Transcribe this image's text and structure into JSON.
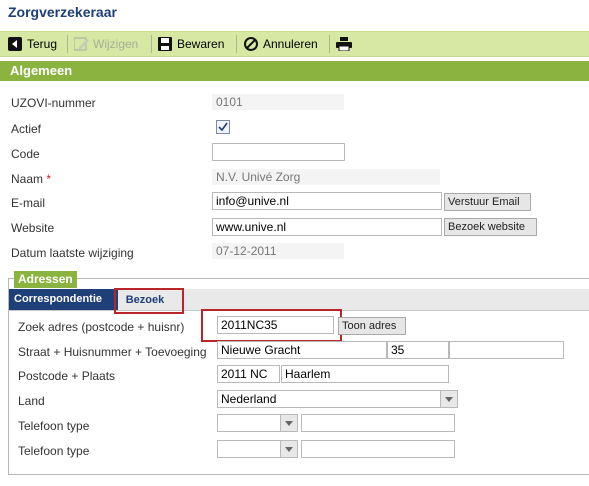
{
  "header": {
    "title": "Zorgverzekeraar"
  },
  "toolbar": {
    "back_label": "Terug",
    "edit_label": "Wijzigen",
    "save_label": "Bewaren",
    "cancel_label": "Annuleren"
  },
  "general": {
    "section_title": "Algemeen",
    "uzovi_label": "UZOVI-nummer",
    "uzovi_value": "0101",
    "active_label": "Actief",
    "active_checked": true,
    "code_label": "Code",
    "code_value": "",
    "name_label": "Naam",
    "name_required_mark": "*",
    "name_value": "N.V. Univé Zorg",
    "email_label": "E-mail",
    "email_value": "info@unive.nl",
    "send_email_label": "Verstuur Email",
    "website_label": "Website",
    "website_value": "www.unive.nl",
    "visit_website_label": "Bezoek website",
    "last_modified_label": "Datum laatste wijziging",
    "last_modified_value": "07-12-2011"
  },
  "addresses": {
    "legend": "Adressen",
    "tabs": [
      "Correspondentie",
      "Bezoek"
    ],
    "search_label": "Zoek adres (postcode + huisnr)",
    "search_value": "2011NC35",
    "show_address_label": "Toon adres",
    "street_label": "Straat + Huisnummer + Toevoeging",
    "street_value": "Nieuwe Gracht",
    "house_number_value": "35",
    "addition_value": "",
    "postcode_label": "Postcode + Plaats",
    "postcode_value": "2011 NC",
    "city_value": "Haarlem",
    "country_label": "Land",
    "country_value": "Nederland",
    "phone1_label": "Telefoon type",
    "phone2_label": "Telefoon type"
  },
  "colors": {
    "accent": "#8ab43f",
    "toolbar_bg": "#d7e8a4",
    "title": "#1e3f77",
    "highlight": "#b8262a"
  }
}
